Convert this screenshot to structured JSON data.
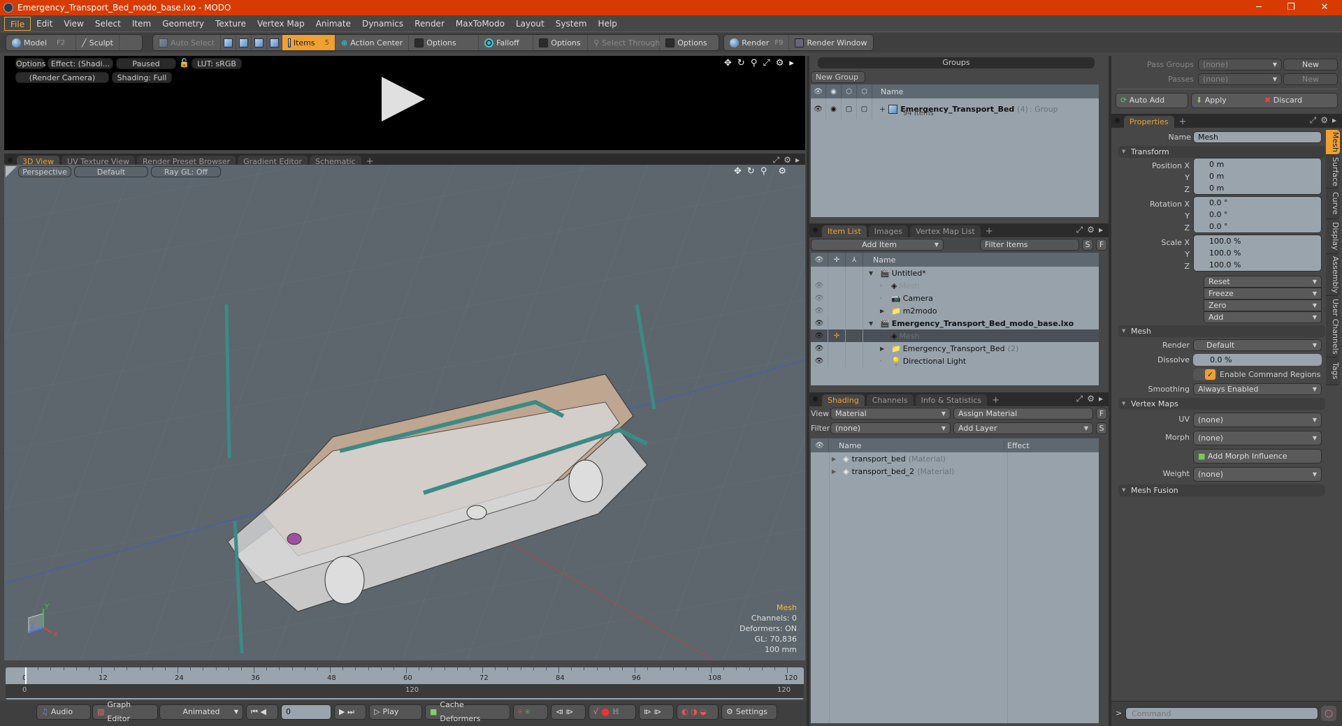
{
  "window": {
    "title": "Emergency_Transport_Bed_modo_base.lxo - MODO",
    "controls": [
      "minimize",
      "restore",
      "close"
    ]
  },
  "menu": [
    "File",
    "Edit",
    "View",
    "Select",
    "Item",
    "Geometry",
    "Texture",
    "Vertex Map",
    "Animate",
    "Dynamics",
    "Render",
    "MaxToModo",
    "Layout",
    "System",
    "Help"
  ],
  "toolbar": {
    "model": "Model",
    "model_key": "F2",
    "sculpt": "Sculpt",
    "auto_select": "Auto Select",
    "items": "Items",
    "items_key": "5",
    "action_center": "Action Center",
    "options1": "Options",
    "falloff": "Falloff",
    "options2": "Options",
    "select_through": "Select Through",
    "options3": "Options",
    "render": "Render",
    "render_key": "F9",
    "render_window": "Render Window"
  },
  "preview": {
    "options": "Options",
    "effect": "Effect: (Shadi...",
    "paused": "Paused",
    "lut": "LUT: sRGB",
    "camera": "(Render Camera)",
    "shading": "Shading: Full"
  },
  "viewport_tabs": [
    "3D View",
    "UV Texture View",
    "Render Preset Browser",
    "Gradient Editor",
    "Schematic"
  ],
  "viewport": {
    "projection": "Perspective",
    "style": "Default",
    "raygl": "Ray GL: Off",
    "info": {
      "selection": "Mesh",
      "channels": "Channels: 0",
      "deformers": "Deformers: ON",
      "gl": "GL: 70,836",
      "unit": "100 mm"
    },
    "axis": {
      "x": "X",
      "y": "Y",
      "z": "Z"
    }
  },
  "groups": {
    "title": "Groups",
    "new_group": "New Group",
    "col_name": "Name",
    "row": {
      "name": "Emergency_Transport_Bed",
      "count": "(4)",
      "type": ": Group",
      "items": "94 Items"
    }
  },
  "item_list": {
    "tabs": [
      "Item List",
      "Images",
      "Vertex Map List"
    ],
    "add_item": "Add Item",
    "filter": "Filter Items",
    "s": "S",
    "f": "F",
    "col_name": "Name",
    "rows": [
      {
        "name": "Untitled*",
        "bold": false,
        "indent": 0
      },
      {
        "name": "Mesh",
        "dim": true,
        "indent": 1
      },
      {
        "name": "Camera",
        "indent": 1
      },
      {
        "name": "m2modo",
        "indent": 1
      },
      {
        "name": "Emergency_Transport_Bed_modo_base.lxo",
        "bold": true,
        "indent": 0
      },
      {
        "name": "Mesh",
        "dim": true,
        "indent": 1,
        "selected": true
      },
      {
        "name": "Emergency_Transport_Bed",
        "suffix": "(2)",
        "indent": 1
      },
      {
        "name": "Directional Light",
        "indent": 1
      }
    ]
  },
  "shading": {
    "tabs": [
      "Shading",
      "Channels",
      "Info & Statistics"
    ],
    "view_label": "View",
    "view_value": "Material",
    "assign": "Assign Material",
    "f": "F",
    "filter_label": "Filter",
    "filter_value": "(none)",
    "add_layer": "Add Layer",
    "s": "S",
    "col_name": "Name",
    "col_effect": "Effect",
    "rows": [
      {
        "name": "transport_bed",
        "type": "(Material)"
      },
      {
        "name": "transport_bed_2",
        "type": "(Material)"
      }
    ]
  },
  "passes": {
    "pass_groups_label": "Pass Groups",
    "pass_groups": "(none)",
    "passes_label": "Passes",
    "passes": "(none)",
    "new1": "New",
    "new2": "New",
    "auto_add": "Auto Add",
    "apply": "Apply",
    "discard": "Discard"
  },
  "properties": {
    "tab": "Properties",
    "name_label": "Name",
    "name_value": "Mesh",
    "transform": "Transform",
    "position_label": "Position X",
    "rotation_label": "Rotation X",
    "scale_label": "Scale X",
    "y": "Y",
    "z": "Z",
    "position": [
      "0 m",
      "0 m",
      "0 m"
    ],
    "rotation": [
      "0.0 °",
      "0.0 °",
      "0.0 °"
    ],
    "scale": [
      "100.0 %",
      "100.0 %",
      "100.0 %"
    ],
    "actions": [
      "Reset",
      "Freeze",
      "Zero",
      "Add"
    ],
    "mesh": "Mesh",
    "render_label": "Render",
    "render_value": "Default",
    "dissolve_label": "Dissolve",
    "dissolve_value": "0.0 %",
    "command_regions": "Enable Command Regions",
    "smoothing_label": "Smoothing",
    "smoothing_value": "Always Enabled",
    "vertex_maps": "Vertex Maps",
    "uv_label": "UV",
    "uv_value": "(none)",
    "morph_label": "Morph",
    "morph_value": "(none)",
    "add_morph": "Add Morph Influence",
    "weight_label": "Weight",
    "weight_value": "(none)",
    "mesh_fusion": "Mesh Fusion",
    "side_tabs": [
      "Mesh",
      "Surface",
      "Curve",
      "Display",
      "Assembly",
      "User Channels",
      "Tags"
    ]
  },
  "timeline": {
    "ticks": [
      "0",
      "12",
      "24",
      "36",
      "48",
      "60",
      "72",
      "84",
      "96",
      "108",
      "120"
    ],
    "range_start": "0",
    "range_mid": "120",
    "range_end": "120"
  },
  "bottom": {
    "audio": "Audio",
    "graph_editor": "Graph Editor",
    "mode": "Animated",
    "frame": "0",
    "play": "Play",
    "cache": "Cache Deformers",
    "settings": "Settings"
  },
  "command": {
    "prompt": ">",
    "placeholder": "Command"
  }
}
